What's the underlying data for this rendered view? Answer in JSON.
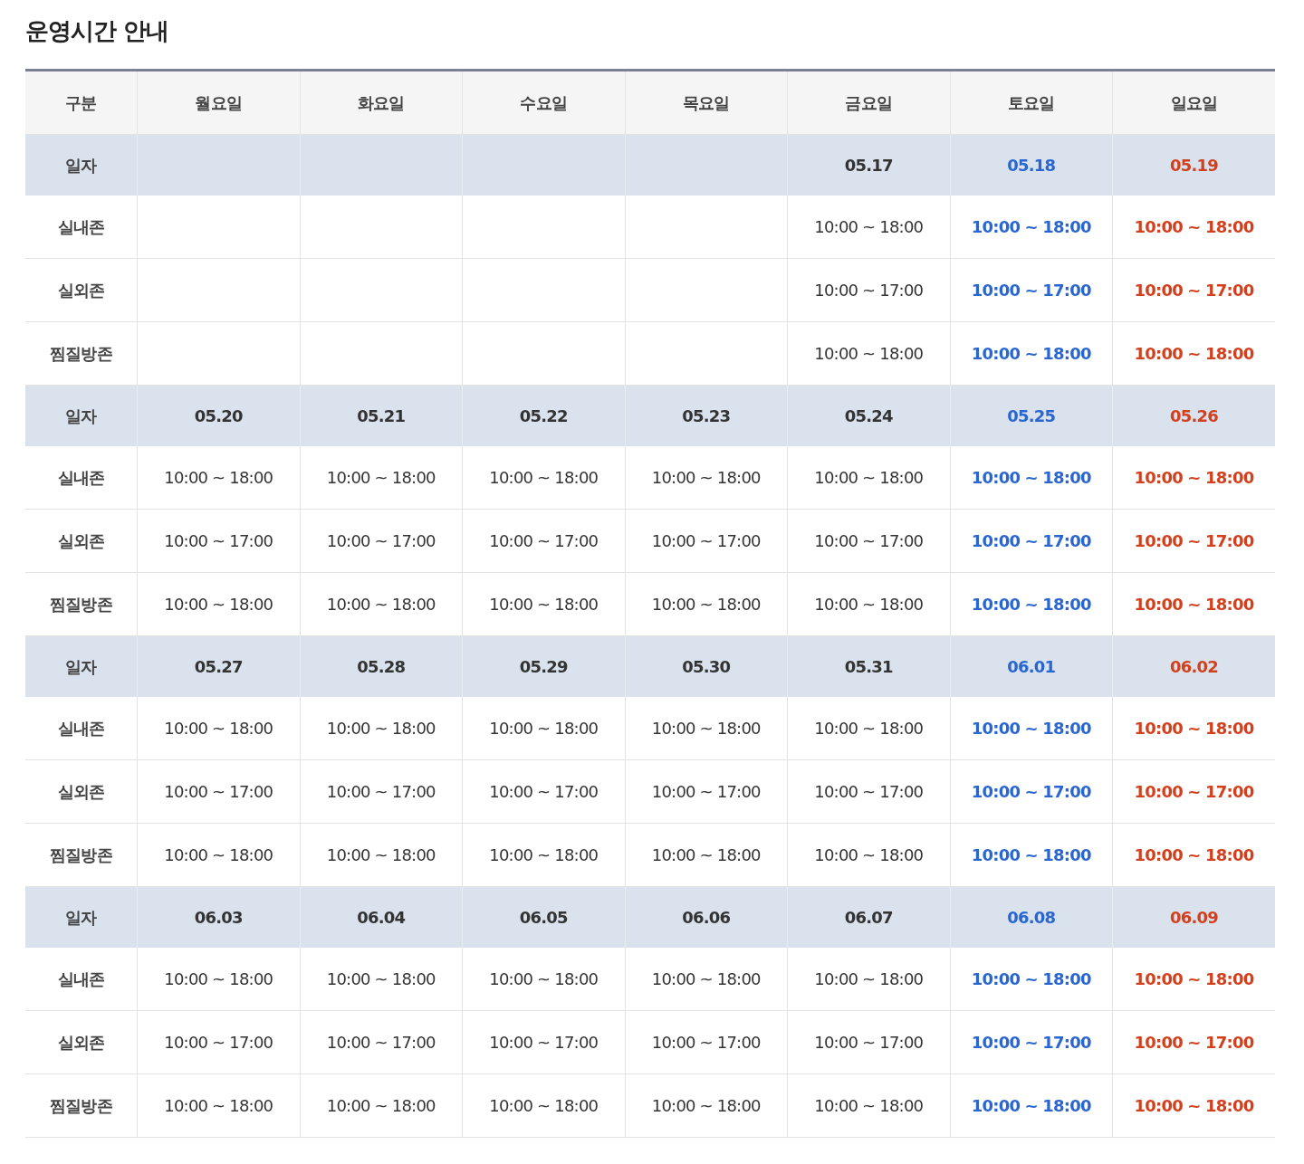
{
  "title": "운영시간 안내",
  "columns": [
    {
      "label": "구분"
    },
    {
      "label": "월요일",
      "kind": "weekday"
    },
    {
      "label": "화요일",
      "kind": "weekday"
    },
    {
      "label": "수요일",
      "kind": "weekday"
    },
    {
      "label": "목요일",
      "kind": "weekday"
    },
    {
      "label": "금요일",
      "kind": "weekday"
    },
    {
      "label": "토요일",
      "kind": "saturday"
    },
    {
      "label": "일요일",
      "kind": "sunday"
    }
  ],
  "rows": [
    {
      "kind": "date",
      "label": "일자",
      "cells": [
        null,
        null,
        null,
        null,
        "05.17",
        "05.18",
        "05.19"
      ]
    },
    {
      "kind": "zone",
      "label": "실내존",
      "cells": [
        null,
        null,
        null,
        null,
        "10:00 ~ 18:00",
        "10:00 ~ 18:00",
        "10:00 ~ 18:00"
      ]
    },
    {
      "kind": "zone",
      "label": "실외존",
      "cells": [
        null,
        null,
        null,
        null,
        "10:00 ~ 17:00",
        "10:00 ~ 17:00",
        "10:00 ~ 17:00"
      ]
    },
    {
      "kind": "zone",
      "label": "찜질방존",
      "cells": [
        null,
        null,
        null,
        null,
        "10:00 ~ 18:00",
        "10:00 ~ 18:00",
        "10:00 ~ 18:00"
      ]
    },
    {
      "kind": "date",
      "label": "일자",
      "cells": [
        "05.20",
        "05.21",
        "05.22",
        "05.23",
        "05.24",
        "05.25",
        "05.26"
      ]
    },
    {
      "kind": "zone",
      "label": "실내존",
      "cells": [
        "10:00 ~ 18:00",
        "10:00 ~ 18:00",
        "10:00 ~ 18:00",
        "10:00 ~ 18:00",
        "10:00 ~ 18:00",
        "10:00 ~ 18:00",
        "10:00 ~ 18:00"
      ]
    },
    {
      "kind": "zone",
      "label": "실외존",
      "cells": [
        "10:00 ~ 17:00",
        "10:00 ~ 17:00",
        "10:00 ~ 17:00",
        "10:00 ~ 17:00",
        "10:00 ~ 17:00",
        "10:00 ~ 17:00",
        "10:00 ~ 17:00"
      ]
    },
    {
      "kind": "zone",
      "label": "찜질방존",
      "cells": [
        "10:00 ~ 18:00",
        "10:00 ~ 18:00",
        "10:00 ~ 18:00",
        "10:00 ~ 18:00",
        "10:00 ~ 18:00",
        "10:00 ~ 18:00",
        "10:00 ~ 18:00"
      ]
    },
    {
      "kind": "date",
      "label": "일자",
      "cells": [
        "05.27",
        "05.28",
        "05.29",
        "05.30",
        "05.31",
        "06.01",
        "06.02"
      ]
    },
    {
      "kind": "zone",
      "label": "실내존",
      "cells": [
        "10:00 ~ 18:00",
        "10:00 ~ 18:00",
        "10:00 ~ 18:00",
        "10:00 ~ 18:00",
        "10:00 ~ 18:00",
        "10:00 ~ 18:00",
        "10:00 ~ 18:00"
      ]
    },
    {
      "kind": "zone",
      "label": "실외존",
      "cells": [
        "10:00 ~ 17:00",
        "10:00 ~ 17:00",
        "10:00 ~ 17:00",
        "10:00 ~ 17:00",
        "10:00 ~ 17:00",
        "10:00 ~ 17:00",
        "10:00 ~ 17:00"
      ]
    },
    {
      "kind": "zone",
      "label": "찜질방존",
      "cells": [
        "10:00 ~ 18:00",
        "10:00 ~ 18:00",
        "10:00 ~ 18:00",
        "10:00 ~ 18:00",
        "10:00 ~ 18:00",
        "10:00 ~ 18:00",
        "10:00 ~ 18:00"
      ]
    },
    {
      "kind": "date",
      "label": "일자",
      "cells": [
        "06.03",
        "06.04",
        "06.05",
        "06.06",
        "06.07",
        "06.08",
        "06.09"
      ]
    },
    {
      "kind": "zone",
      "label": "실내존",
      "cells": [
        "10:00 ~ 18:00",
        "10:00 ~ 18:00",
        "10:00 ~ 18:00",
        "10:00 ~ 18:00",
        "10:00 ~ 18:00",
        "10:00 ~ 18:00",
        "10:00 ~ 18:00"
      ]
    },
    {
      "kind": "zone",
      "label": "실외존",
      "cells": [
        "10:00 ~ 17:00",
        "10:00 ~ 17:00",
        "10:00 ~ 17:00",
        "10:00 ~ 17:00",
        "10:00 ~ 17:00",
        "10:00 ~ 17:00",
        "10:00 ~ 17:00"
      ]
    },
    {
      "kind": "zone",
      "label": "찜질방존",
      "cells": [
        "10:00 ~ 18:00",
        "10:00 ~ 18:00",
        "10:00 ~ 18:00",
        "10:00 ~ 18:00",
        "10:00 ~ 18:00",
        "10:00 ~ 18:00",
        "10:00 ~ 18:00"
      ]
    }
  ]
}
